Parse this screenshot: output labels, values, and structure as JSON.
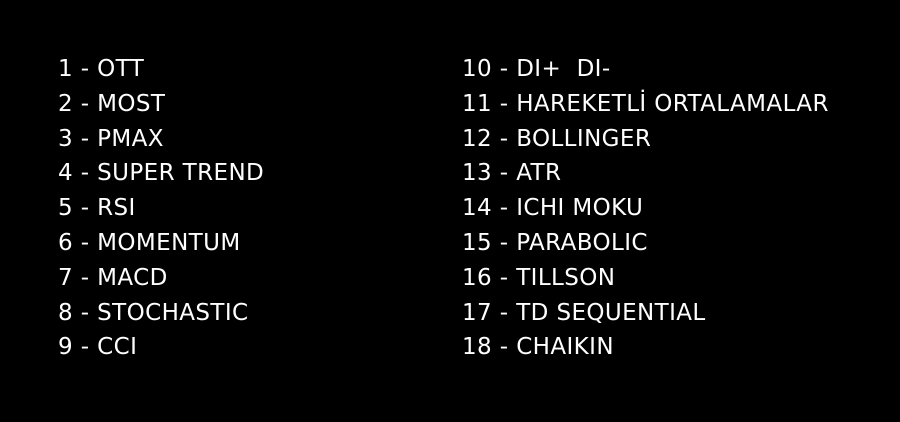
{
  "left_column": [
    "1 - OTT",
    "2 - MOST",
    "3 - PMAX",
    "4 - SUPER TREND",
    "5 - RSI",
    "6 - MOMENTUM",
    "7 - MACD",
    "8 - STOCHASTIC",
    "9 - CCI"
  ],
  "right_column": [
    "10 - DI+  DI-",
    "11 - HAREKETLİ ORTALAMALAR",
    "12 - BOLLINGER",
    "13 - ATR",
    "14 - ICHI MOKU",
    "15 - PARABOLIC",
    "16 - TILLSON",
    "17 - TD SEQUENTIAL",
    "18 - CHAIKIN"
  ],
  "colors": {
    "background": "#000000",
    "text": "#ffffff"
  }
}
